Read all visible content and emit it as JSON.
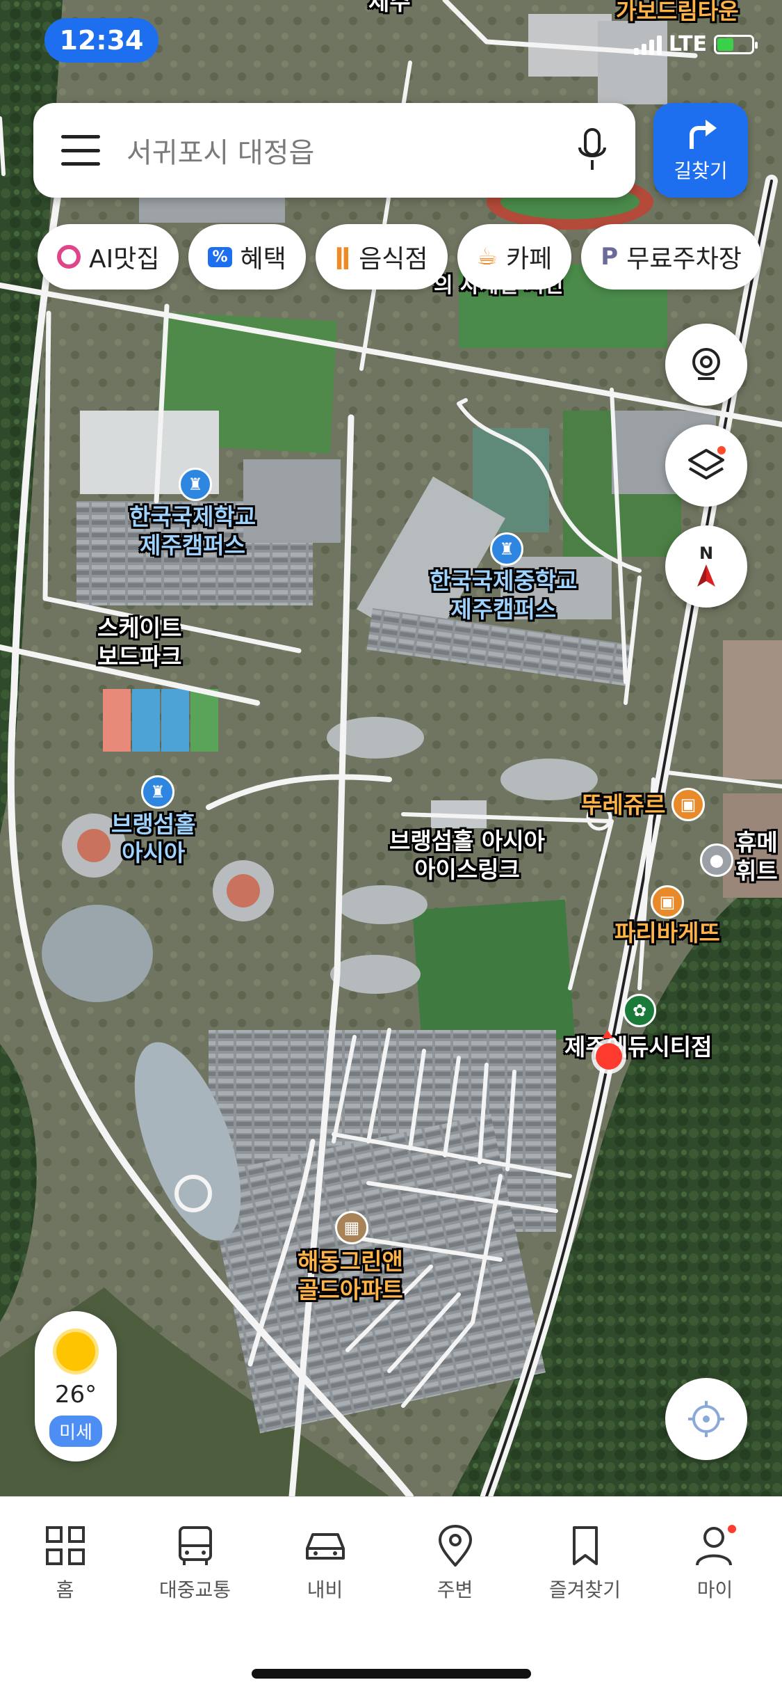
{
  "status_bar": {
    "time": "12:34",
    "network": "LTE"
  },
  "search": {
    "placeholder": "서귀포시 대정읍",
    "directions_label": "길찾기"
  },
  "chips": [
    {
      "icon": "ai-ring-icon",
      "label": "AI맛집"
    },
    {
      "icon": "discount-icon",
      "label": "혜택"
    },
    {
      "icon": "restaurant-icon",
      "label": "음식점"
    },
    {
      "icon": "coffee-cup-icon",
      "label": "카페"
    },
    {
      "icon": "parking-icon",
      "label": "무료주차장"
    }
  ],
  "map_labels": {
    "top_cut": "제주",
    "gabo_dream_town": "가보드림타운",
    "top_partial": "의 사계절 시민",
    "kis_jeju": [
      "한국국제학교",
      "제주캠퍼스"
    ],
    "kis_middle": [
      "한국국제중학교",
      "제주캠퍼스"
    ],
    "skate_park": [
      "스케이트",
      "보드파크"
    ],
    "branksome": [
      "브랭섬홀",
      "아시아"
    ],
    "ice_rink": [
      "브랭섬홀 아시아",
      "아이스링크"
    ],
    "tous_les_jours": "뚜레쥬르",
    "paris_baguette": "파리바게뜨",
    "starbucks": "제주에듀시티점",
    "green_gold": [
      "해동그린앤",
      "골드아파트"
    ],
    "right_edge": [
      "휴메",
      "휘트"
    ]
  },
  "weather": {
    "temperature": "26°",
    "dust_label": "미세"
  },
  "bottom_nav": [
    {
      "icon": "home-grid-icon",
      "label": "홈"
    },
    {
      "icon": "bus-icon",
      "label": "대중교통"
    },
    {
      "icon": "car-icon",
      "label": "내비"
    },
    {
      "icon": "location-pin-icon",
      "label": "주변"
    },
    {
      "icon": "bookmark-icon",
      "label": "즐겨찾기"
    },
    {
      "icon": "person-icon",
      "label": "마이"
    }
  ],
  "colors": {
    "accent": "#1e6ff0",
    "road": "#f4f4f4",
    "location_dot": "#ff3b30"
  }
}
